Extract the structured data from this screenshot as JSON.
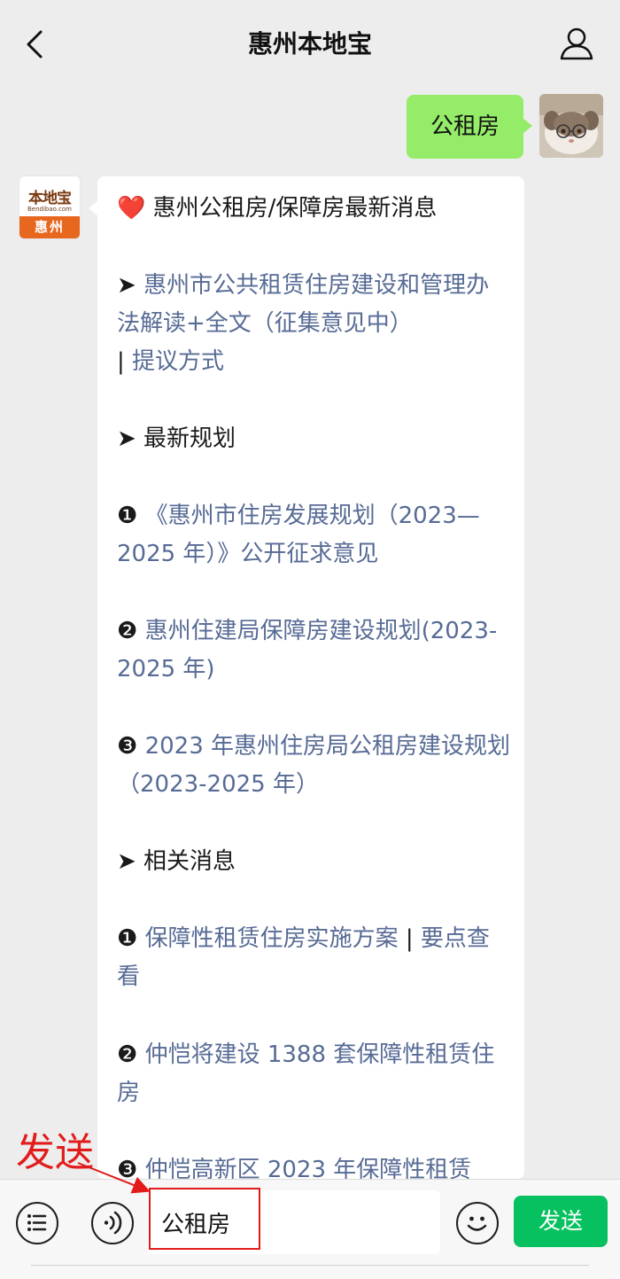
{
  "header": {
    "title": "惠州本地宝"
  },
  "sent_message": {
    "text": "公租房"
  },
  "bot_avatar": {
    "logo_text": "本地宝",
    "logo_url": "Bendibao.com",
    "city": "惠州"
  },
  "received_message": {
    "heading_icon": "❤️",
    "heading": "惠州公租房/保障房最新消息",
    "item1_marker": "➤ ",
    "item1_link": "惠州市公共租赁住房建设和管理办法解读+全文（征集意见中）",
    "item1_sep": "| ",
    "item1_link2": "提议方式",
    "section1": "➤ 最新规划",
    "plan1_marker": "❶ ",
    "plan1_link": "《惠州市住房发展规划（2023—2025 年）》公开征求意见",
    "plan2_marker": "❷ ",
    "plan2_link": "惠州住建局保障房建设规划(2023-2025 年)",
    "plan3_marker": "❸ ",
    "plan3_link": "2023 年惠州住房局公租房建设规划（2023-2025 年）",
    "section2": "➤ 相关消息",
    "news1_marker": "❶ ",
    "news1_link": "保障性租赁住房实施方案",
    "news1_sep": " | ",
    "news1_link2": "要点查看",
    "news2_marker": "❷ ",
    "news2_link": "仲恺将建设 1388 套保障性租赁住房",
    "news3_marker": "❸ ",
    "news3_link": "仲恺高新区 2023 年保障性租赁"
  },
  "input_bar": {
    "text_value": "公租房",
    "send_label": "发送"
  },
  "annotation": {
    "label": "发送"
  },
  "colors": {
    "sent_bubble": "#95ec69",
    "link": "#576b95",
    "send_button": "#07c160",
    "annotation": "#e21b1b"
  }
}
